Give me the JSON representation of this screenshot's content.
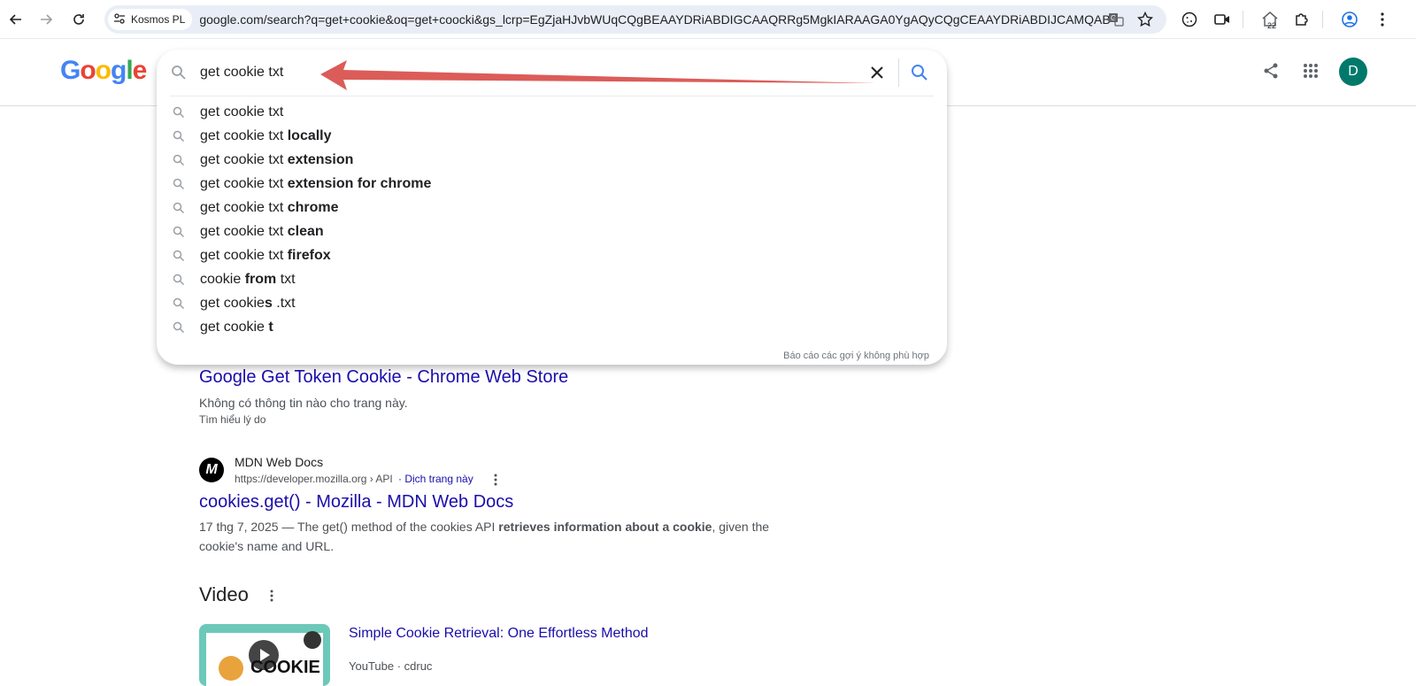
{
  "browser": {
    "site_chip": "Kosmos PL",
    "url": "google.com/search?q=get+cookie&oq=get+coocki&gs_lcrp=EgZjaHJvbWUqCQgBEAAYDRiABDIGCAAQRRg5MgkIARAAGA0YgAQyCQgCEAAYDRiABDIJCAMQABg...",
    "badge_count": "22"
  },
  "google": {
    "logo_letters": [
      "G",
      "o",
      "o",
      "g",
      "l",
      "e"
    ],
    "logo_colors": [
      "#4285f4",
      "#ea4335",
      "#fbbc05",
      "#4285f4",
      "#34a853",
      "#ea4335"
    ],
    "avatar_letter": "D"
  },
  "search": {
    "query": "get cookie txt",
    "suggestions": [
      {
        "plain": "get cookie txt",
        "bold": ""
      },
      {
        "plain": "get cookie txt ",
        "bold": "locally"
      },
      {
        "plain": "get cookie txt ",
        "bold": "extension"
      },
      {
        "plain": "get cookie txt ",
        "bold": "extension for chrome"
      },
      {
        "plain": "get cookie txt ",
        "bold": "chrome"
      },
      {
        "plain": "get cookie txt ",
        "bold": "clean"
      },
      {
        "plain": "get cookie txt ",
        "bold": "firefox"
      },
      {
        "plain": "cookie ",
        "bold": "from",
        "tail": " txt"
      },
      {
        "plain": "get cookie",
        "bold": "s",
        "tail": " .txt"
      },
      {
        "plain": "get cookie ",
        "bold": "t"
      }
    ],
    "report_text": "Báo cáo các gợi ý không phù hợp"
  },
  "results": {
    "r1": {
      "title": "Google Get Token Cookie - Chrome Web Store",
      "snippet": "Không có thông tin nào cho trang này.",
      "why": "Tìm hiểu lý do"
    },
    "r2": {
      "logo": "M",
      "site": "MDN Web Docs",
      "cite": "https://developer.mozilla.org › API",
      "translate": "· Dịch trang này",
      "title": "cookies.get() - Mozilla - MDN Web Docs",
      "snippet_pre": "17 thg 7, 2025 — The get() method of the cookies API ",
      "snippet_bold": "retrieves information about a cookie",
      "snippet_post": ", given the cookie's name and URL."
    },
    "video_heading": "Video",
    "video_title": "Simple Cookie Retrieval: One Effortless Method",
    "video_meta": "YouTube · cdruc",
    "video_thumb_text": "COOKIE"
  }
}
